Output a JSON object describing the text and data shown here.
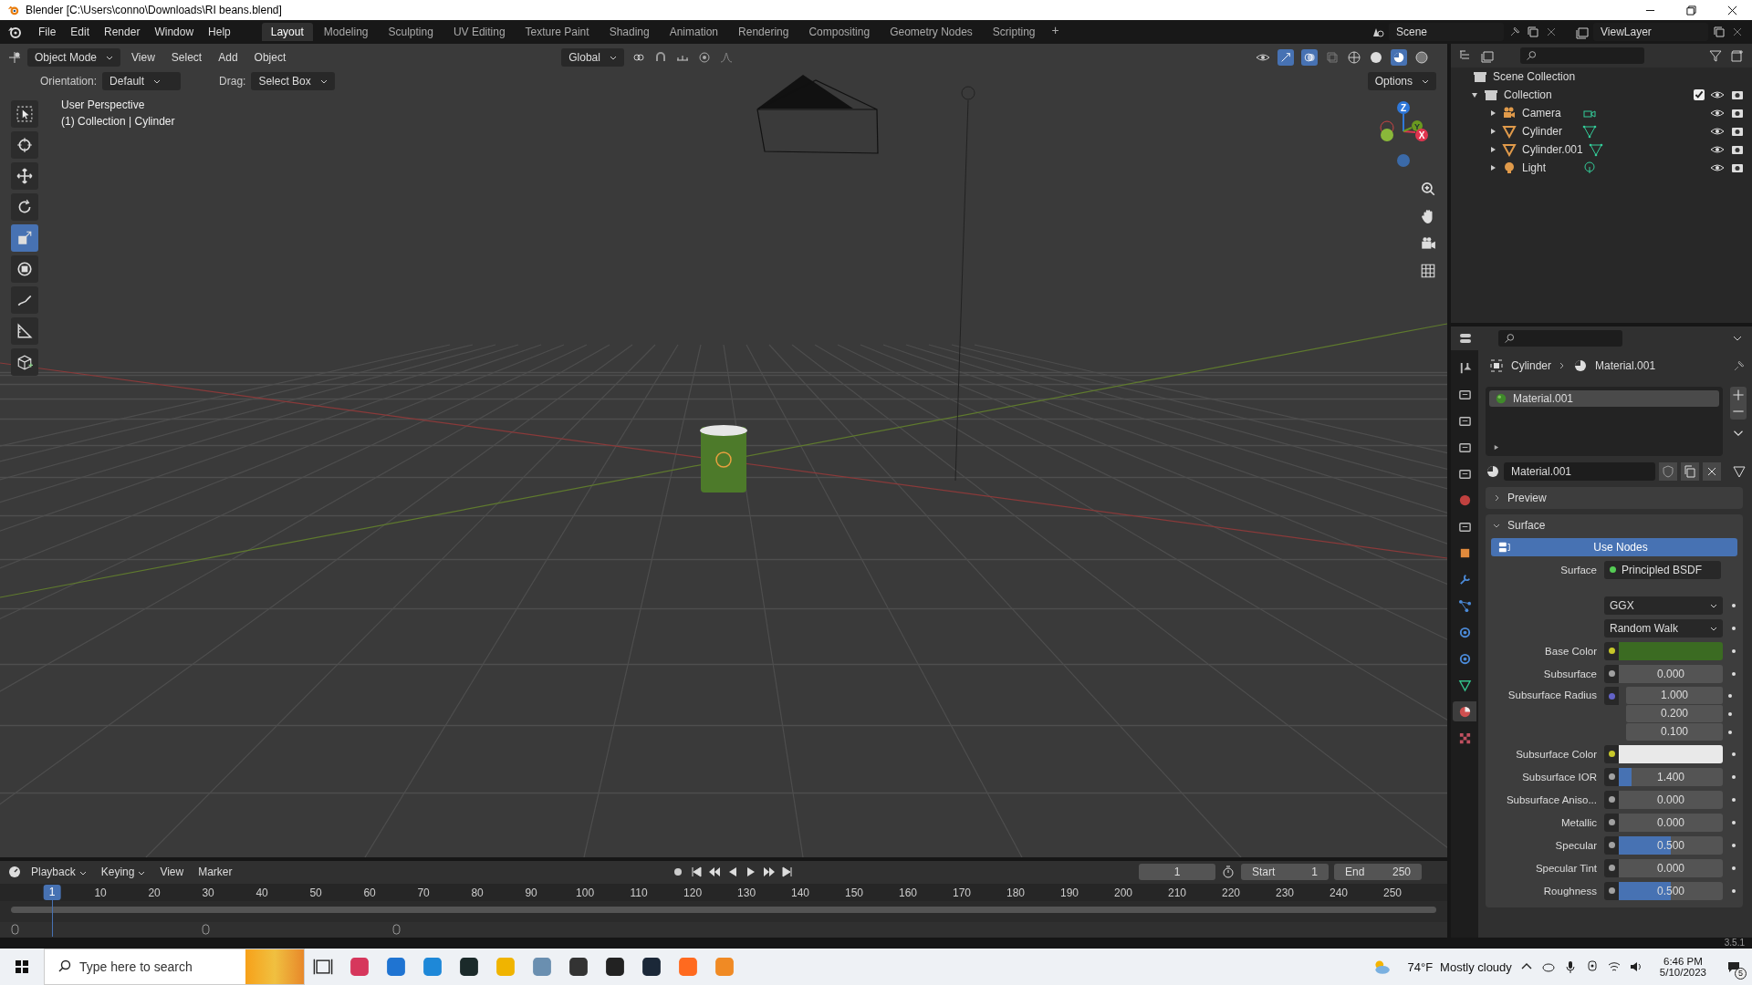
{
  "window": {
    "title": "Blender [C:\\Users\\conno\\Downloads\\RI beans.blend]"
  },
  "menu": [
    "File",
    "Edit",
    "Render",
    "Window",
    "Help"
  ],
  "workspaces": [
    {
      "label": "Layout",
      "selected": true
    },
    {
      "label": "Modeling",
      "selected": false
    },
    {
      "label": "Sculpting",
      "selected": false
    },
    {
      "label": "UV Editing",
      "selected": false
    },
    {
      "label": "Texture Paint",
      "selected": false
    },
    {
      "label": "Shading",
      "selected": false
    },
    {
      "label": "Animation",
      "selected": false
    },
    {
      "label": "Rendering",
      "selected": false
    },
    {
      "label": "Compositing",
      "selected": false
    },
    {
      "label": "Geometry Nodes",
      "selected": false
    },
    {
      "label": "Scripting",
      "selected": false
    }
  ],
  "add_workspace": "+",
  "scene": "Scene",
  "view_layer": "ViewLayer",
  "viewport": {
    "mode": "Object Mode",
    "menus": [
      "View",
      "Select",
      "Add",
      "Object"
    ],
    "transform_orientation": "Global",
    "orientation_label": "Orientation:",
    "orientation": "Default",
    "drag_label": "Drag:",
    "drag": "Select Box",
    "options": "Options",
    "overlay_title": "User Perspective",
    "overlay_info": "(1) Collection | Cylinder",
    "tools": [
      {
        "kind": "select",
        "selected": false
      },
      {
        "kind": "cursor",
        "selected": false
      },
      {
        "kind": "move",
        "selected": false
      },
      {
        "kind": "rotate",
        "selected": false
      },
      {
        "kind": "scale",
        "selected": true
      },
      {
        "kind": "transform",
        "selected": false
      },
      {
        "kind": "annotate",
        "selected": false
      },
      {
        "kind": "measure",
        "selected": false
      },
      {
        "kind": "add-cube",
        "selected": false
      }
    ],
    "gizmo": [
      {
        "label": "Z",
        "color": "#2f78d9"
      },
      {
        "label": "Y",
        "color": "#6b9a1f"
      },
      {
        "label": "X",
        "color": "#e0344f"
      }
    ]
  },
  "outliner": {
    "root": "Scene Collection",
    "items": [
      {
        "name": "Collection",
        "kind": "collection",
        "checked": true,
        "expanded": true,
        "children": [
          {
            "name": "Camera",
            "kind": "camera",
            "expanded": false
          },
          {
            "name": "Cylinder",
            "kind": "mesh",
            "expanded": false
          },
          {
            "name": "Cylinder.001",
            "kind": "mesh",
            "expanded": false
          },
          {
            "name": "Light",
            "kind": "light",
            "expanded": false
          }
        ]
      }
    ]
  },
  "properties": {
    "tabs": [
      {
        "kind": "tool",
        "selected": false
      },
      {
        "kind": "render",
        "selected": false
      },
      {
        "kind": "output",
        "selected": false
      },
      {
        "kind": "view-layer",
        "selected": false
      },
      {
        "kind": "scene",
        "selected": false
      },
      {
        "kind": "world",
        "selected": false
      },
      {
        "kind": "collection",
        "selected": false
      },
      {
        "kind": "object",
        "selected": false
      },
      {
        "kind": "modifier",
        "selected": false
      },
      {
        "kind": "particles",
        "selected": false
      },
      {
        "kind": "physics",
        "selected": false
      },
      {
        "kind": "constraint",
        "selected": false
      },
      {
        "kind": "data",
        "selected": false
      },
      {
        "kind": "material",
        "selected": true
      },
      {
        "kind": "texture",
        "selected": false
      }
    ],
    "breadcrumb": [
      "Cylinder",
      "Material.001"
    ],
    "slots": [
      {
        "name": "Material.001",
        "selected": true
      }
    ],
    "material": "Material.001",
    "panels": [
      {
        "title": "Preview",
        "expanded": false
      },
      {
        "title": "Surface",
        "expanded": true
      }
    ],
    "use_nodes": "Use Nodes",
    "surface_label": "Surface",
    "surface_shader": "Principled BSDF",
    "fields": [
      {
        "kind": "dropdown",
        "value": "GGX"
      },
      {
        "kind": "dropdown",
        "value": "Random Walk"
      },
      {
        "kind": "color",
        "label": "Base Color",
        "color": "#3b6b22"
      },
      {
        "kind": "slider",
        "label": "Subsurface",
        "value": "0.000",
        "level": 0
      },
      {
        "kind": "vector",
        "label": "Subsurface Radius",
        "values": [
          "1.000",
          "0.200",
          "0.100"
        ]
      },
      {
        "kind": "color",
        "label": "Subsurface Color",
        "color": "#e9e9e9"
      },
      {
        "kind": "slider",
        "label": "Subsurface IOR",
        "value": "1.400",
        "level": 0.12
      },
      {
        "kind": "slider",
        "label": "Subsurface Aniso...",
        "value": "0.000",
        "level": 0
      },
      {
        "kind": "slider",
        "label": "Metallic",
        "value": "0.000",
        "level": 0
      },
      {
        "kind": "slider",
        "label": "Specular",
        "value": "0.500",
        "level": 0.5
      },
      {
        "kind": "slider",
        "label": "Specular Tint",
        "value": "0.000",
        "level": 0
      },
      {
        "kind": "slider",
        "label": "Roughness",
        "value": "0.500",
        "level": 0.5
      }
    ]
  },
  "timeline": {
    "menus": [
      "Playback",
      "Keying",
      "View",
      "Marker"
    ],
    "current_frame": "1",
    "start_label": "Start",
    "start": "1",
    "end_label": "End",
    "end": "250",
    "ticks": [
      "1",
      "10",
      "20",
      "30",
      "40",
      "50",
      "60",
      "70",
      "80",
      "90",
      "100",
      "110",
      "120",
      "130",
      "140",
      "150",
      "160",
      "170",
      "180",
      "190",
      "200",
      "210",
      "220",
      "230",
      "240",
      "250"
    ]
  },
  "version": "3.5.1",
  "taskbar": {
    "search_placeholder": "Type here to search",
    "temperature": "74°F",
    "weather": "Mostly cloudy",
    "time": "6:46 PM",
    "date": "5/10/2023",
    "notification_count": "5"
  }
}
